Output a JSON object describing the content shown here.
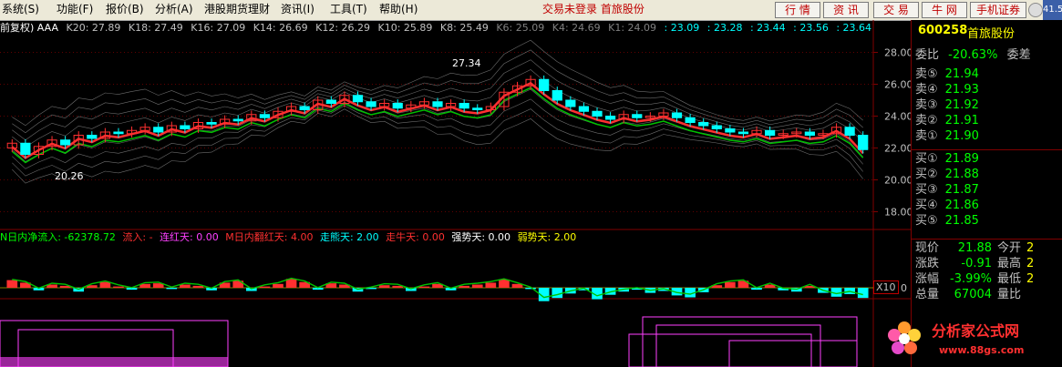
{
  "menu": {
    "items": [
      "系统(S)",
      "功能(F)",
      "报价(B)",
      "分析(A)",
      "港股期货理财",
      "资讯(I)",
      "工具(T)",
      "帮助(H)"
    ],
    "status": "交易未登录  首旅股份",
    "buttons": [
      "行 情",
      "资 讯",
      "交 易",
      "牛 网",
      "手机证券"
    ],
    "tray_badge": "41.5"
  },
  "ma_row": {
    "prefix": "前复权) AAA",
    "items": [
      "K20: 27.89",
      "K18: 27.49",
      "K16: 27.09",
      "K14: 26.69",
      "K12: 26.29",
      "K10: 25.89",
      "K8: 25.49",
      "K6: 25.09",
      "K4: 24.69",
      "K1: 24.09"
    ],
    "values": [
      ": 23.09",
      ": 23.28",
      ": 23.44",
      ": 23.56",
      ": 23.64"
    ],
    "tail": ": · : ·"
  },
  "colors": {
    "up": "#ff3030",
    "down": "#00ffff",
    "axis": "#800000",
    "grid": "#600000",
    "green_line": "#00c000",
    "magenta": "#ff40ff"
  },
  "price_axis": {
    "labels": [
      "28.00",
      "26.00",
      "24.00",
      "22.00",
      "20.00",
      "18.00"
    ],
    "values": [
      28,
      26,
      24,
      22,
      20,
      18
    ]
  },
  "annotations": {
    "high": "27.34",
    "low": "20.26"
  },
  "chart_data": {
    "type": "candlestick",
    "series_closes": [
      22.3,
      21.6,
      22.1,
      22.5,
      22.2,
      22.8,
      22.6,
      23.0,
      22.9,
      23.1,
      23.3,
      23.0,
      23.4,
      23.2,
      23.6,
      23.5,
      23.8,
      23.7,
      24.1,
      23.9,
      24.3,
      24.6,
      24.4,
      25.0,
      24.8,
      25.3,
      24.9,
      24.6,
      24.8,
      24.5,
      24.7,
      24.9,
      24.6,
      24.8,
      24.5,
      24.4,
      24.6,
      25.5,
      25.9,
      26.3,
      25.6,
      25.0,
      24.6,
      24.3,
      24.0,
      23.8,
      24.1,
      23.9,
      24.0,
      24.2,
      23.9,
      23.6,
      23.4,
      23.2,
      23.0,
      22.9,
      23.1,
      22.8,
      22.9,
      23.0,
      22.8,
      22.9,
      23.3,
      22.8,
      21.9
    ],
    "high_price": 27.34,
    "low_price": 20.26,
    "ylim": [
      17,
      29
    ]
  },
  "indicator": {
    "label_main": "N日内净流入: -62378.72",
    "label_flow": "流入: -",
    "label_lianhong": "连红天: 0.00",
    "label_m": "M日内翻红天: 4.00",
    "label_zouxiong": "走熊天: 2.00",
    "label_zouniu": "走牛天: 0.00",
    "label_qiang": "强势天: 0.00",
    "label_ruo": "弱势天: 2.00",
    "axis_zero": "0",
    "x10": "X10",
    "values": [
      1.2,
      0.8,
      -0.4,
      0.5,
      0.3,
      -0.6,
      0.4,
      0.9,
      0.2,
      -0.3,
      0.6,
      0.7,
      -0.2,
      0.5,
      0.3,
      -0.4,
      0.8,
      1.1,
      -0.5,
      0.2,
      0.6,
      1.4,
      0.9,
      -0.3,
      0.7,
      0.5,
      -0.6,
      -0.2,
      0.4,
      0.3,
      -0.5,
      0.2,
      0.6,
      -0.4,
      0.3,
      0.5,
      0.8,
      1.3,
      0.6,
      -0.2,
      -2.1,
      -1.6,
      -0.9,
      -0.4,
      -1.8,
      -1.1,
      -0.6,
      -0.3,
      -0.8,
      -0.5,
      -1.2,
      -1.5,
      -0.7,
      0.4,
      0.9,
      1.1,
      -0.3,
      0.5,
      -0.4,
      -0.6,
      0.3,
      -0.8,
      -1.4,
      -1.0,
      -1.6
    ]
  },
  "side": {
    "code": "600258",
    "name": "首旅股份",
    "weibi_label": "委比",
    "weibi_value": "-20.63%",
    "weicha_label": "委差",
    "sells": [
      {
        "label": "卖⑤",
        "price": "21.94"
      },
      {
        "label": "卖④",
        "price": "21.93"
      },
      {
        "label": "卖③",
        "price": "21.92"
      },
      {
        "label": "卖②",
        "price": "21.91"
      },
      {
        "label": "卖①",
        "price": "21.90"
      }
    ],
    "buys": [
      {
        "label": "买①",
        "price": "21.89"
      },
      {
        "label": "买②",
        "price": "21.88"
      },
      {
        "label": "买③",
        "price": "21.87"
      },
      {
        "label": "买④",
        "price": "21.86"
      },
      {
        "label": "买⑤",
        "price": "21.85"
      }
    ],
    "stats": [
      {
        "label": "现价",
        "value": "21.88",
        "label2": "今开",
        "value2": "2"
      },
      {
        "label": "涨跌",
        "value": "-0.91",
        "label2": "最高",
        "value2": "2"
      },
      {
        "label": "涨幅",
        "value": "-3.99%",
        "label2": "最低",
        "value2": "2"
      },
      {
        "label": "总量",
        "value": "67004",
        "label2": "量比",
        "value2": ""
      }
    ]
  },
  "watermark": {
    "name": "分析家公式网",
    "url": "www.88gs.com"
  }
}
